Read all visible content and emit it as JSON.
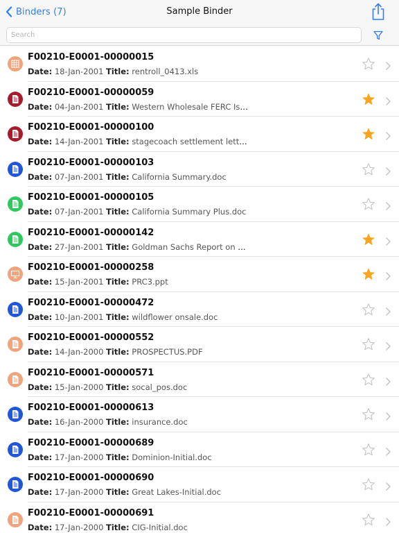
{
  "nav": {
    "back_label": "Binders (7)",
    "title": "Sample Binder",
    "share_icon": "share-icon",
    "accent_color": "#2f7cf6"
  },
  "search": {
    "placeholder": "Search",
    "value": "",
    "filter_icon": "filter-icon"
  },
  "labels": {
    "date": "Date:",
    "title": "Title:"
  },
  "colors": {
    "spreadsheet": "#f0a47c",
    "red-doc": "#a81c2a",
    "blue-doc": "#2057d8",
    "green-doc": "#2ec95e",
    "orange-doc": "#f0a47c",
    "star_on": "#f5a623",
    "star_off": "#c7c7cc"
  },
  "rows": [
    {
      "id": "F00210-E0001-00000015",
      "date": "18-Jan-2001",
      "title": "rentroll_0413.xls",
      "icon": "spreadsheet",
      "starred": false
    },
    {
      "id": "F00210-E0001-00000059",
      "date": "04-Jan-2001",
      "title": "Western Wholesale FERC Issues.doc",
      "icon": "red-doc",
      "starred": true
    },
    {
      "id": "F00210-E0001-00000100",
      "date": "14-Jan-2001",
      "title": "stagecoach settlement letter to ku...",
      "icon": "red-doc",
      "starred": true
    },
    {
      "id": "F00210-E0001-00000103",
      "date": "07-Jan-2001",
      "title": "California Summary.doc",
      "icon": "blue-doc",
      "starred": false
    },
    {
      "id": "F00210-E0001-00000105",
      "date": "07-Jan-2001",
      "title": "California Summary Plus.doc",
      "icon": "green-doc",
      "starred": false
    },
    {
      "id": "F00210-E0001-00000142",
      "date": "27-Jan-2001",
      "title": "Goldman Sachs Report on Enron -...",
      "icon": "green-doc",
      "starred": true
    },
    {
      "id": "F00210-E0001-00000258",
      "date": "15-Jan-2001",
      "title": "PRC3.ppt",
      "icon": "presentation",
      "starred": true
    },
    {
      "id": "F00210-E0001-00000472",
      "date": "10-Jan-2001",
      "title": "wildflower onsale.doc",
      "icon": "blue-doc",
      "starred": false
    },
    {
      "id": "F00210-E0001-00000552",
      "date": "14-Jan-2000",
      "title": "PROSPECTUS.PDF",
      "icon": "orange-doc",
      "starred": false
    },
    {
      "id": "F00210-E0001-00000571",
      "date": "15-Jan-2000",
      "title": "socal_pos.doc",
      "icon": "orange-doc",
      "starred": false
    },
    {
      "id": "F00210-E0001-00000613",
      "date": "16-Jan-2000",
      "title": "insurance.doc",
      "icon": "blue-doc",
      "starred": false
    },
    {
      "id": "F00210-E0001-00000689",
      "date": "17-Jan-2000",
      "title": "Dominion-Initial.doc",
      "icon": "blue-doc",
      "starred": false
    },
    {
      "id": "F00210-E0001-00000690",
      "date": "17-Jan-2000",
      "title": "Great Lakes-Initial.doc",
      "icon": "blue-doc",
      "starred": false
    },
    {
      "id": "F00210-E0001-00000691",
      "date": "17-Jan-2000",
      "title": "CIG-Initial.doc",
      "icon": "orange-doc",
      "starred": false
    }
  ]
}
